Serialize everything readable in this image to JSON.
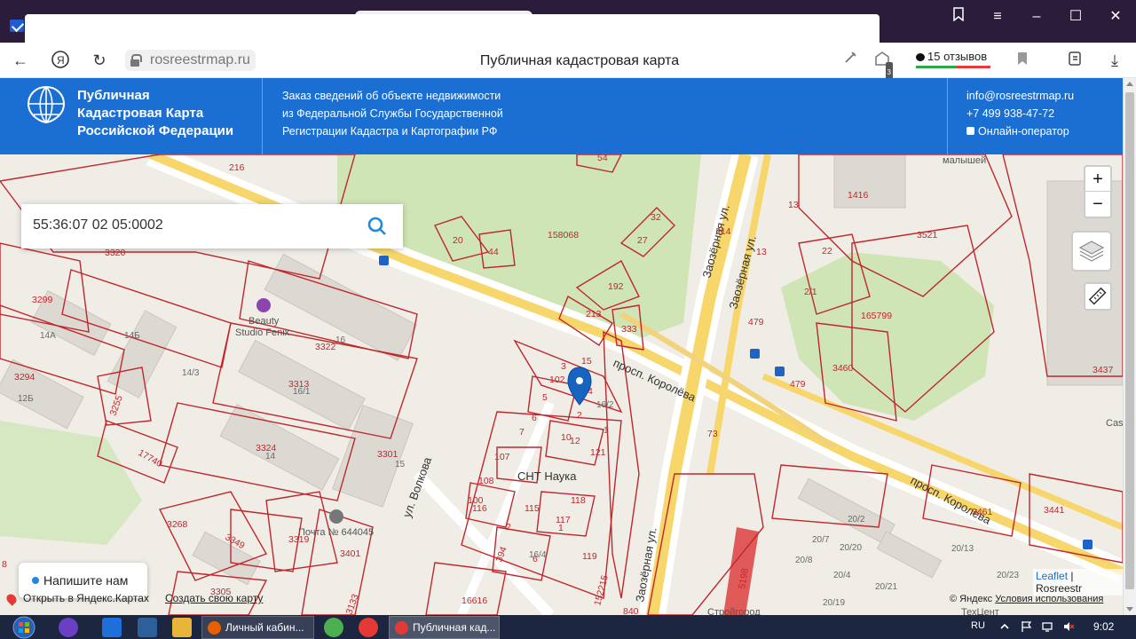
{
  "browser": {
    "url": "rosreestrmap.ru",
    "page_title": "Публичная кадастровая карта",
    "reviews_label": "15 отзывов",
    "tab_badge": "3"
  },
  "header": {
    "brand_lines": [
      "Публичная",
      "Кадастровая Карта",
      "Российской Федерации"
    ],
    "info_lines": [
      "Заказ сведений об объекте недвижимости",
      "из Федеральной Службы Государственной",
      "Регистрации Кадастра и Картографии РФ"
    ],
    "email": "info@rosreestrmap.ru",
    "phone": "+7 499 938-47-72",
    "operator": "Онлайн-оператор"
  },
  "search": {
    "query": "55:36:07 02 05:0002"
  },
  "map": {
    "zoom_in": "+",
    "zoom_out": "−",
    "streets": {
      "korolyova_1": "просп. Королёва",
      "korolyova_2": "просп. Королёва",
      "zaozernaya_1": "Заозёрная ул.",
      "zaozernaya_2": "Заозёрная ул.",
      "zaozernaya_3": "Заозёрная ул.",
      "volkova": "ул. Волкова"
    },
    "places": {
      "snt": "СНТ Наука",
      "beauty_1": "Beauty",
      "beauty_2": "Studio Fenix",
      "post": "Почта № 644045",
      "malyshey": "малышей",
      "stroigorod": "Стройгород",
      "tehcent": "ТехЦент",
      "cas": "Cas"
    },
    "plots": [
      "216",
      "54",
      "20",
      "44",
      "158068",
      "32",
      "27",
      "192",
      "213",
      "333",
      "214",
      "13",
      "1416",
      "3521",
      "22",
      "2/1",
      "165799",
      "479",
      "3460",
      "3437",
      "3320",
      "3299",
      "3322",
      "3313",
      "3294",
      "3255",
      "3324",
      "17740",
      "3301",
      "3268",
      "3349",
      "3319",
      "3401",
      "3305",
      "3133",
      "16616",
      "102",
      "3",
      "15",
      "4",
      "5",
      "6",
      "2",
      "7",
      "10",
      "12",
      "108",
      "107",
      "121",
      "73",
      "100",
      "116",
      "115",
      "118",
      "117",
      "1",
      "2",
      "394",
      "6",
      "119",
      "152215",
      "8",
      "840",
      "3461",
      "3441",
      "20/2",
      "20/7",
      "20/20",
      "20/8",
      "20/4",
      "20/21",
      "20/13",
      "20/23",
      "20/19",
      "5198",
      "13",
      "479"
    ],
    "buildings": [
      "14А",
      "14Б",
      "14/3",
      "12Б",
      "16",
      "16/1",
      "14",
      "15",
      "1",
      "16/2",
      "16/4"
    ],
    "chat_label": "Напишите нам",
    "open_in_yandex": "Открыть в Яндекс.Картах",
    "create_map": "Создать свою карту",
    "attrib_leaflet": "Leaflet",
    "attrib_sep": " | ",
    "attrib_rosreestr": "Rosreestr",
    "attrib_yandex": "© Яндекс",
    "attrib_terms": "Условия использования"
  },
  "taskbar": {
    "task1": "Личный кабин...",
    "task2": "Публичная кад...",
    "lang": "RU",
    "time": "9:02"
  },
  "colors": {
    "header_blue": "#1b6fd3",
    "plot_red": "#c0272d",
    "road_yellow": "#f7d66b",
    "park_green": "#cfe5b6",
    "marker_blue": "#1565c0"
  }
}
